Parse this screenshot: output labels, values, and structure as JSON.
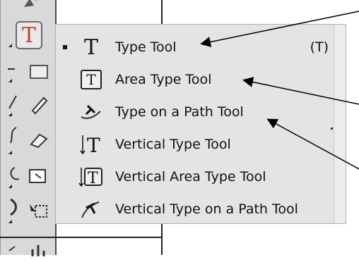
{
  "menu": {
    "items": [
      {
        "label": "Type Tool",
        "shortcut": "(T)",
        "icon": "type-tool-icon",
        "selected": true
      },
      {
        "label": "Area Type Tool",
        "shortcut": "",
        "icon": "area-type-tool-icon",
        "selected": false
      },
      {
        "label": "Type on a Path Tool",
        "shortcut": "",
        "icon": "type-on-path-tool-icon",
        "selected": false
      },
      {
        "label": "Vertical Type Tool",
        "shortcut": "",
        "icon": "vertical-type-tool-icon",
        "selected": false
      },
      {
        "label": "Vertical Area Type Tool",
        "shortcut": "",
        "icon": "vertical-area-type-tool-icon",
        "selected": false
      },
      {
        "label": "Vertical Type on a Path Tool",
        "shortcut": "",
        "icon": "vertical-type-on-path-tool-icon",
        "selected": false
      }
    ]
  },
  "toolbox": {
    "active_tool_glyph": "T",
    "active_color": "#c0442a"
  },
  "colors": {
    "menu_bg": "#e4e4e4",
    "toolbox_bg": "#d9d9d9",
    "annotation_arrow": "#000000"
  }
}
